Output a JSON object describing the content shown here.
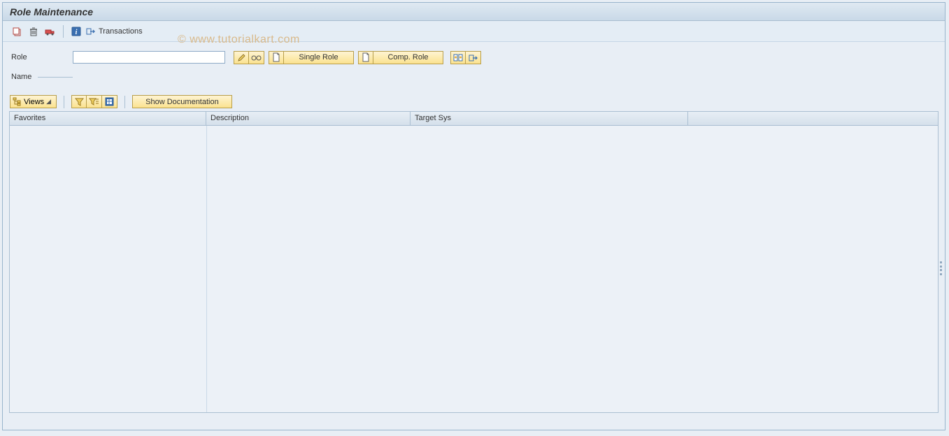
{
  "title": "Role Maintenance",
  "toolbar": {
    "transactions_label": "Transactions"
  },
  "form": {
    "role_label": "Role",
    "role_value": "",
    "name_label": "Name",
    "single_role_label": "Single Role",
    "comp_role_label": "Comp. Role"
  },
  "mid_toolbar": {
    "views_label": "Views",
    "show_doc_label": "Show Documentation"
  },
  "table": {
    "columns": {
      "favorites": "Favorites",
      "description": "Description",
      "target_sys": "Target Sys"
    }
  },
  "watermark": "© www.tutorialkart.com",
  "icons": {
    "copy": "copy-icon",
    "delete": "delete-icon",
    "transport": "transport-icon",
    "info": "info-icon",
    "breakout": "breakout-icon",
    "edit": "pencil-icon",
    "display": "glasses-icon",
    "new_doc": "document-icon",
    "compare": "compare-icon",
    "export": "export-icon",
    "tree": "tree-icon",
    "filter": "filter-icon",
    "filter_more": "filter-plus-icon",
    "layout": "layout-icon"
  }
}
